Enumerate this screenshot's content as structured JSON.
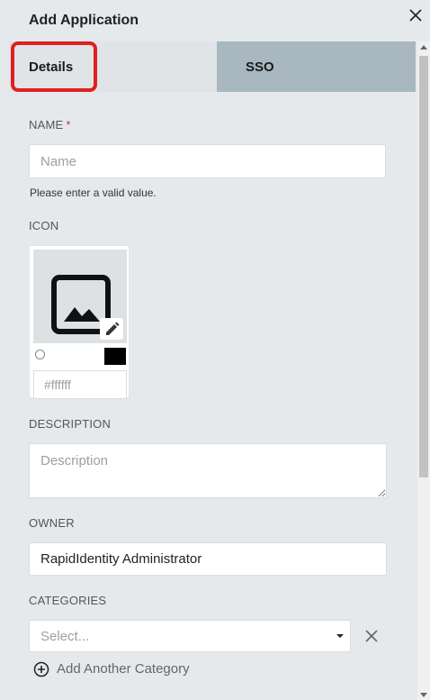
{
  "dialog": {
    "title": "Add Application"
  },
  "tabs": [
    {
      "label": "Details",
      "active": true
    },
    {
      "label": "SSO",
      "active": false
    }
  ],
  "form": {
    "name": {
      "label": "NAME",
      "required_mark": "*",
      "placeholder": "Name",
      "value": "",
      "error": "Please enter a valid value."
    },
    "icon": {
      "label": "ICON",
      "image_icon": "image-icon",
      "edit_icon": "pencil-icon",
      "color_placeholder": "#ffffff",
      "swatch_color": "#000000"
    },
    "description": {
      "label": "DESCRIPTION",
      "placeholder": "Description",
      "value": ""
    },
    "owner": {
      "label": "OWNER",
      "value": "RapidIdentity Administrator"
    },
    "categories": {
      "label": "CATEGORIES",
      "placeholder": "Select...",
      "add_label": "Add Another Category"
    }
  },
  "colors": {
    "highlight": "#e02020",
    "required": "#d32f2f",
    "sso_tab": "#a9b7c0"
  }
}
